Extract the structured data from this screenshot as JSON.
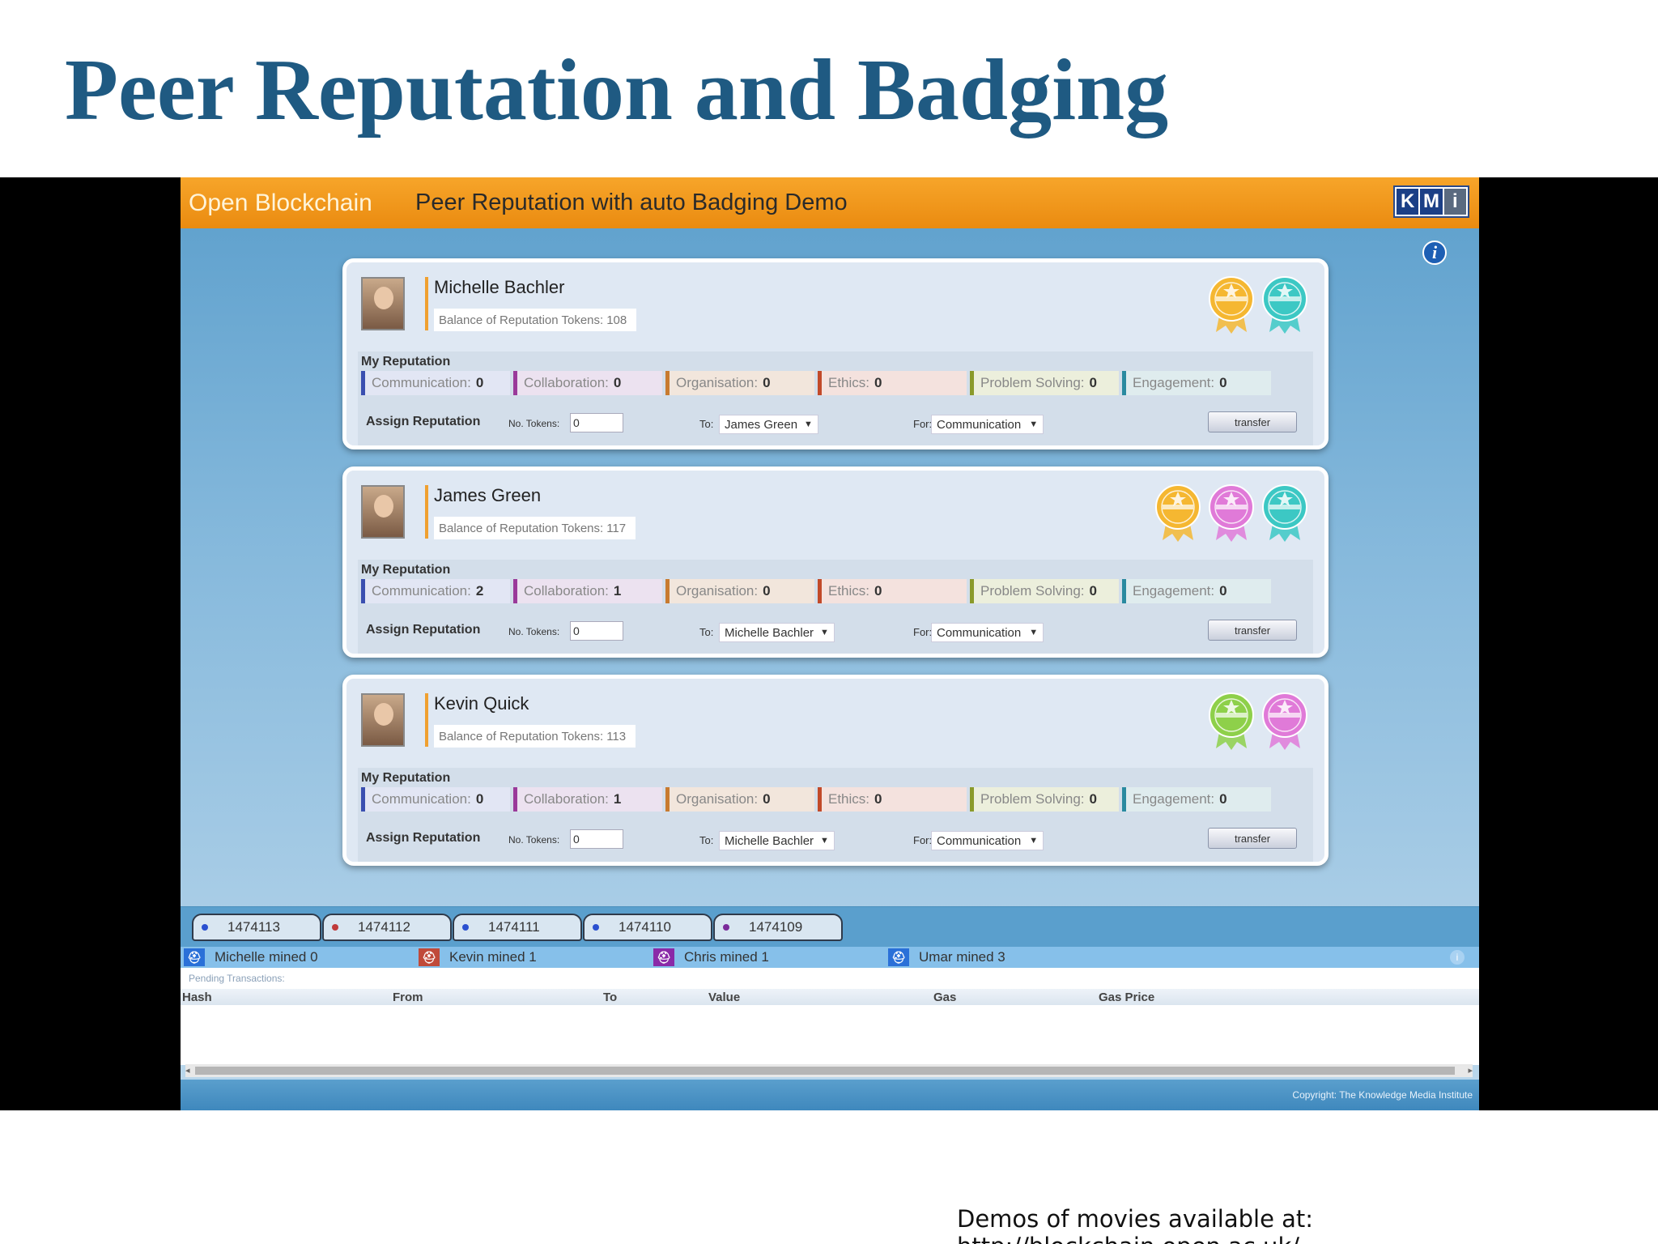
{
  "slide": {
    "title": "Peer Reputation and Badging",
    "footer_note": "Demos of movies available at: http://blockchain.open.ac.uk/"
  },
  "app": {
    "brand": "Open Blockchain",
    "title": "Peer Reputation with auto Badging Demo",
    "logo_letters": [
      "K",
      "M",
      "i"
    ],
    "info_icon": "info-icon"
  },
  "users": [
    {
      "name": "Michelle Bachler",
      "balance_label": "Balance of Reputation Tokens:",
      "balance": "108",
      "badges": [
        "gold",
        "teal"
      ],
      "reputation_title": "My Reputation",
      "reputation": [
        {
          "label": "Communication:",
          "value": "0"
        },
        {
          "label": "Collaboration:",
          "value": "0"
        },
        {
          "label": "Organisation:",
          "value": "0"
        },
        {
          "label": "Ethics:",
          "value": "0"
        },
        {
          "label": "Problem Solving:",
          "value": "0"
        },
        {
          "label": "Engagement:",
          "value": "0"
        }
      ],
      "assign_label": "Assign Reputation",
      "tokens_label": "No. Tokens:",
      "tokens_value": "0",
      "to_label": "To:",
      "to_value": "James Green",
      "for_label": "For:",
      "for_value": "Communication",
      "transfer_label": "transfer"
    },
    {
      "name": "James Green",
      "balance_label": "Balance of Reputation Tokens:",
      "balance": "117",
      "badges": [
        "gold",
        "pink",
        "teal"
      ],
      "reputation_title": "My Reputation",
      "reputation": [
        {
          "label": "Communication:",
          "value": "2"
        },
        {
          "label": "Collaboration:",
          "value": "1"
        },
        {
          "label": "Organisation:",
          "value": "0"
        },
        {
          "label": "Ethics:",
          "value": "0"
        },
        {
          "label": "Problem Solving:",
          "value": "0"
        },
        {
          "label": "Engagement:",
          "value": "0"
        }
      ],
      "assign_label": "Assign Reputation",
      "tokens_label": "No. Tokens:",
      "tokens_value": "0",
      "to_label": "To:",
      "to_value": "Michelle Bachler",
      "for_label": "For:",
      "for_value": "Communication",
      "transfer_label": "transfer"
    },
    {
      "name": "Kevin Quick",
      "balance_label": "Balance of Reputation Tokens:",
      "balance": "113",
      "badges": [
        "green",
        "pink"
      ],
      "reputation_title": "My Reputation",
      "reputation": [
        {
          "label": "Communication:",
          "value": "0"
        },
        {
          "label": "Collaboration:",
          "value": "1"
        },
        {
          "label": "Organisation:",
          "value": "0"
        },
        {
          "label": "Ethics:",
          "value": "0"
        },
        {
          "label": "Problem Solving:",
          "value": "0"
        },
        {
          "label": "Engagement:",
          "value": "0"
        }
      ],
      "assign_label": "Assign Reputation",
      "tokens_label": "No. Tokens:",
      "tokens_value": "0",
      "to_label": "To:",
      "to_value": "Michelle Bachler",
      "for_label": "For:",
      "for_value": "Communication",
      "transfer_label": "transfer"
    }
  ],
  "badge_colors": {
    "gold": "#f5b731",
    "teal": "#3cc8c4",
    "pink": "#e07ad8",
    "green": "#8ed04a"
  },
  "blocks": [
    {
      "number": "1474113",
      "color": "#2a50d0"
    },
    {
      "number": "1474112",
      "color": "#c03a3a"
    },
    {
      "number": "1474111",
      "color": "#2a50d0"
    },
    {
      "number": "1474110",
      "color": "#2a50d0"
    },
    {
      "number": "1474109",
      "color": "#7a2a9a"
    }
  ],
  "miners": [
    {
      "label": "Michelle mined 0",
      "color": "#2a70d8"
    },
    {
      "label": "Kevin mined 1",
      "color": "#c04a3a"
    },
    {
      "label": "Chris mined 1",
      "color": "#8a2aa8"
    },
    {
      "label": "Umar mined 3",
      "color": "#2a70d8"
    }
  ],
  "pending": {
    "label": "Pending Transactions:",
    "columns": [
      "Hash",
      "From",
      "To",
      "Value",
      "Gas",
      "Gas Price"
    ]
  },
  "copyright": "Copyright: The Knowledge Media Institute"
}
